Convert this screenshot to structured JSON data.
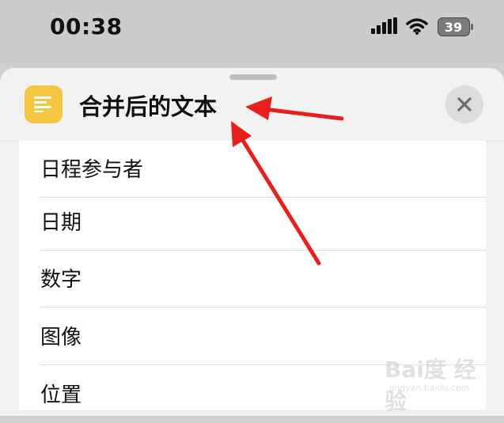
{
  "status_bar": {
    "time": "00:38",
    "battery_level": "39"
  },
  "sheet": {
    "title": "合并后的文本",
    "app_icon": "text-lines-icon",
    "close_icon": "close-icon"
  },
  "list": {
    "items": [
      {
        "label": "日程参与者"
      },
      {
        "label": "日期"
      },
      {
        "label": "数字"
      },
      {
        "label": "图像"
      },
      {
        "label": "位置"
      }
    ]
  },
  "annotation": {
    "arrow_color": "#e8201d"
  },
  "colors": {
    "icon_yellow": "#f5c641"
  },
  "watermark": {
    "brand": "Bai度 经验",
    "domain": "jingyan.baidu.com"
  }
}
